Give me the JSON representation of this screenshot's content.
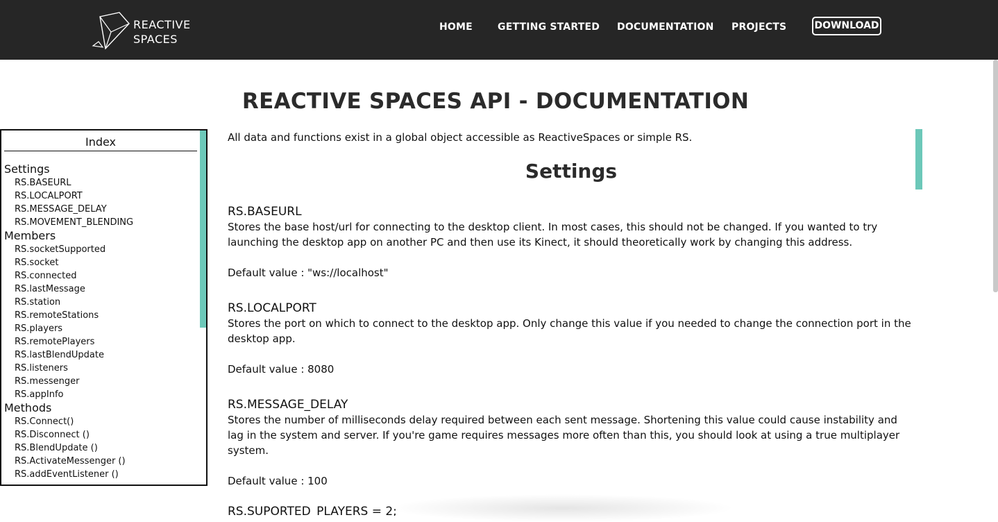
{
  "header": {
    "logo_text_line1": "REACTIVE",
    "logo_text_line2": "SPACES",
    "nav": {
      "home": "HOME",
      "getting_started": "GETTING STARTED",
      "documentation": "DOCUMENTATION",
      "projects": "PROJECTS",
      "download": "DOWNLOAD"
    }
  },
  "page_title": "REACTIVE SPACES API - DOCUMENTATION",
  "index": {
    "title": "Index",
    "settings_label": "Settings",
    "settings": [
      "RS.BASEURL",
      "RS.LOCALPORT",
      "RS.MESSAGE_DELAY",
      "RS.MOVEMENT_BLENDING"
    ],
    "members_label": "Members",
    "members": [
      "RS.socketSupported",
      "RS.socket",
      "RS.connected",
      "RS.lastMessage",
      "RS.station",
      "RS.remoteStations",
      "RS.players",
      "RS.remotePlayers",
      "RS.lastBlendUpdate",
      "RS.listeners",
      "RS.messenger",
      "RS.appInfo"
    ],
    "methods_label": "Methods",
    "methods": [
      "RS.Connect()",
      "RS.Disconnect ()",
      "RS.BlendUpdate ()",
      "RS.ActivateMessenger ()",
      "RS.addEventListener ()"
    ]
  },
  "main": {
    "intro": "All data and functions exist in a global object accessible as ReactiveSpaces or simple RS.",
    "section_title": "Settings",
    "entries": [
      {
        "name": "RS.BASEURL",
        "desc_line1": "Stores the base host/url for connecting to the desktop client. In most cases, this should not be changed. If you wanted to try",
        "desc_line2": "launching the desktop app on another PC and then use its Kinect, it should theoretically work by changing this address.",
        "default": "Default value : \"ws://localhost\""
      },
      {
        "name": "RS.LOCALPORT",
        "desc_line1": "Stores the port on which to connect to the desktop app. Only change this value if you needed to change the connection port in the",
        "desc_line2": "desktop app.",
        "default": "Default value : 8080"
      },
      {
        "name": "RS.MESSAGE_DELAY",
        "desc_line1": "Stores the number of milliseconds delay required between each sent message. Shortening this value could cause instability and",
        "desc_line2": "lag in the system and server. If you're game requires messages more often than this, you should look at using a true multiplayer",
        "desc_line3": "system.",
        "default": "Default value : 100"
      },
      {
        "name": "RS.SUPORTED_PLAYERS = 2;"
      }
    ]
  },
  "colors": {
    "header_bg": "#262626",
    "accent_scrollbar": "#6cc8b9"
  }
}
